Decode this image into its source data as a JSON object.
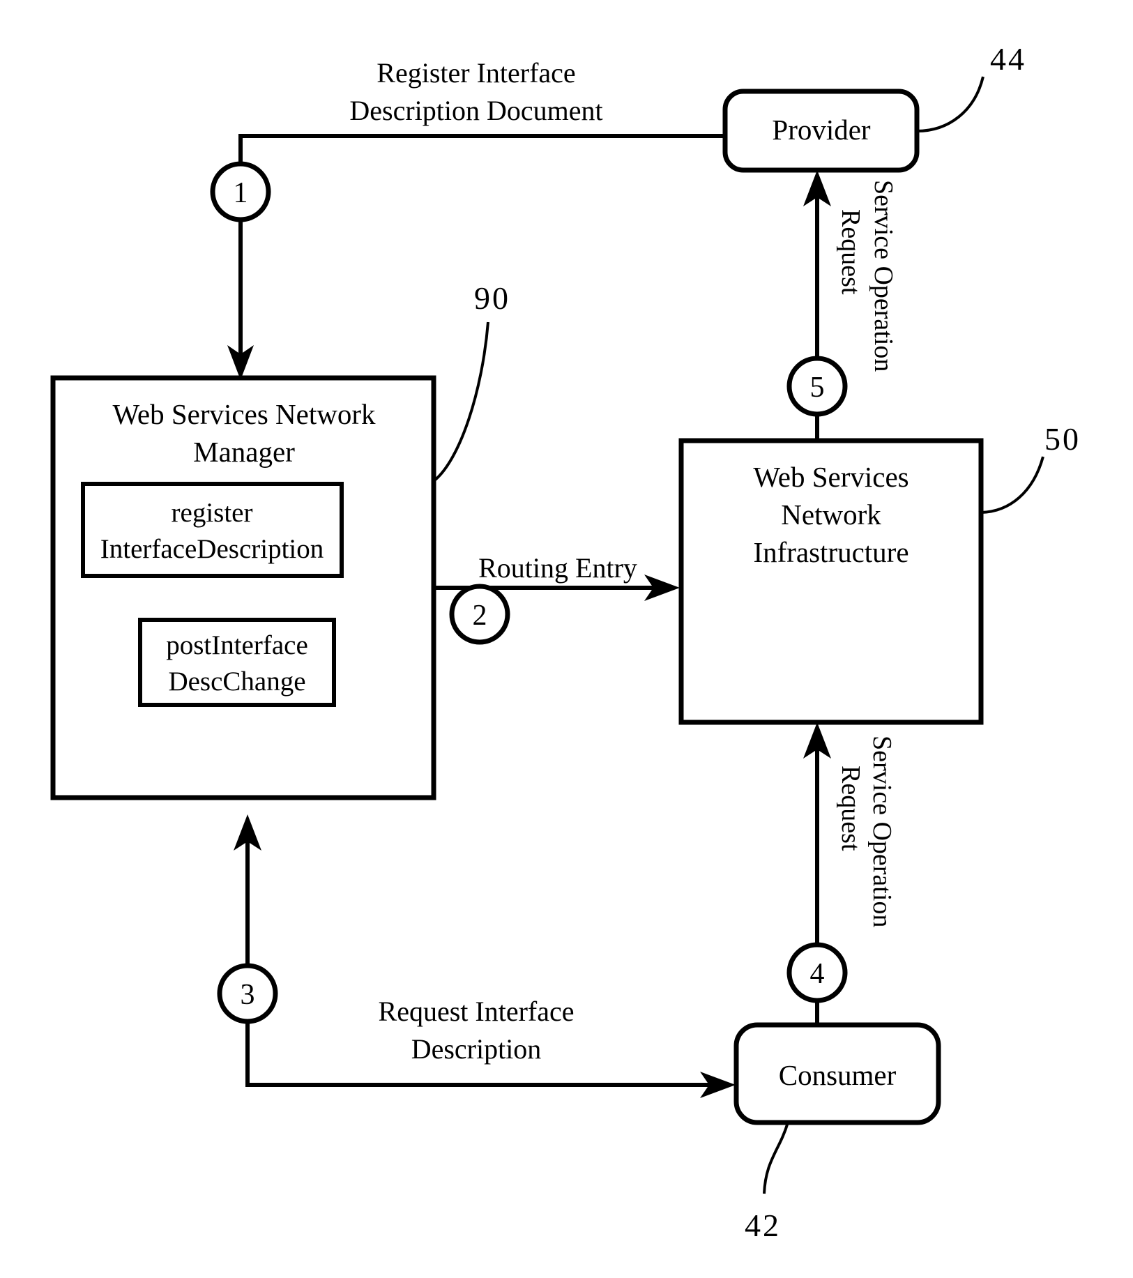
{
  "figure": {
    "title": "Web Services Network registration and request flow diagram",
    "background": "#ffffff",
    "ink": "#000000"
  },
  "nodes": {
    "provider": {
      "label": "Provider",
      "shape": "rounded-rectangle",
      "ref": "44"
    },
    "manager": {
      "label_line1": "Web Services Network",
      "label_line2": "Manager",
      "shape": "rectangle",
      "ref": "90",
      "inner": [
        {
          "label_line1": "register",
          "label_line2": "InterfaceDescription"
        },
        {
          "label_line1": "postInterface",
          "label_line2": "DescChange"
        }
      ]
    },
    "infrastructure": {
      "label_line1": "Web Services",
      "label_line2": "Network",
      "label_line3": "Infrastructure",
      "shape": "rectangle",
      "ref": "50"
    },
    "consumer": {
      "label": "Consumer",
      "shape": "rounded-rectangle",
      "ref": "42"
    }
  },
  "edges": [
    {
      "step": "1",
      "label_line1": "Register Interface",
      "label_line2": "Description Document",
      "from": "provider",
      "to": "manager",
      "orientation": "horizontal-then-down"
    },
    {
      "step": "2",
      "label_line1": "Routing Entry",
      "label_line2": "",
      "from": "manager",
      "to": "infrastructure",
      "orientation": "horizontal"
    },
    {
      "step": "3",
      "label_line1": "Request Interface",
      "label_line2": "Description",
      "from": "consumer",
      "to": "manager",
      "orientation": "horizontal-then-up"
    },
    {
      "step": "4",
      "label_line1": "Service Operation",
      "label_line2": "Request",
      "from": "consumer",
      "to": "infrastructure",
      "orientation": "vertical-up-rotated-label"
    },
    {
      "step": "5",
      "label_line1": "Service Operation",
      "label_line2": "Request",
      "from": "infrastructure",
      "to": "provider",
      "orientation": "vertical-up-rotated-label"
    }
  ],
  "step_markers": [
    "1",
    "2",
    "3",
    "4",
    "5"
  ],
  "reference_numerals": [
    "44",
    "90",
    "50",
    "42"
  ]
}
